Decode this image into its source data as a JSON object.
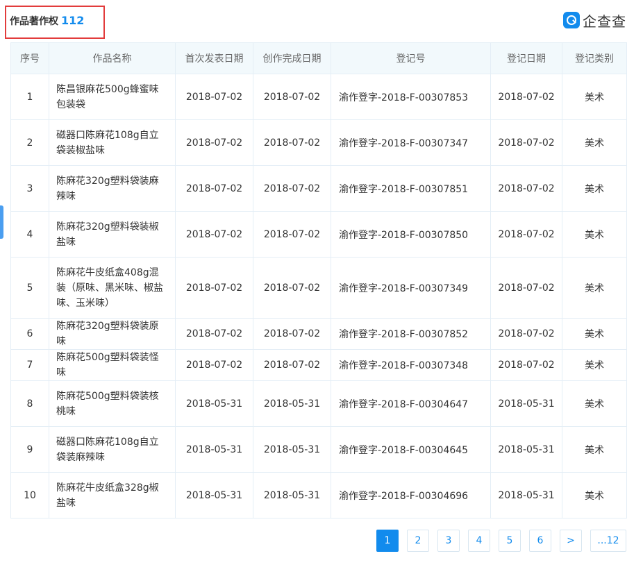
{
  "header": {
    "title": "作品著作权",
    "count": "112",
    "logo_text": "企查查"
  },
  "table": {
    "columns": [
      "序号",
      "作品名称",
      "首次发表日期",
      "创作完成日期",
      "登记号",
      "登记日期",
      "登记类别"
    ],
    "rows": [
      {
        "idx": "1",
        "name": "陈昌银麻花500g蜂蜜味包装袋",
        "first_pub": "2018-07-02",
        "completed": "2018-07-02",
        "reg_no": "渝作登字-2018-F-00307853",
        "reg_date": "2018-07-02",
        "category": "美术"
      },
      {
        "idx": "2",
        "name": "磁器口陈麻花108g自立袋装椒盐味",
        "first_pub": "2018-07-02",
        "completed": "2018-07-02",
        "reg_no": "渝作登字-2018-F-00307347",
        "reg_date": "2018-07-02",
        "category": "美术"
      },
      {
        "idx": "3",
        "name": "陈麻花320g塑料袋装麻辣味",
        "first_pub": "2018-07-02",
        "completed": "2018-07-02",
        "reg_no": "渝作登字-2018-F-00307851",
        "reg_date": "2018-07-02",
        "category": "美术"
      },
      {
        "idx": "4",
        "name": "陈麻花320g塑料袋装椒盐味",
        "first_pub": "2018-07-02",
        "completed": "2018-07-02",
        "reg_no": "渝作登字-2018-F-00307850",
        "reg_date": "2018-07-02",
        "category": "美术"
      },
      {
        "idx": "5",
        "name": "陈麻花牛皮纸盒408g混装（原味、黑米味、椒盐味、玉米味）",
        "first_pub": "2018-07-02",
        "completed": "2018-07-02",
        "reg_no": "渝作登字-2018-F-00307349",
        "reg_date": "2018-07-02",
        "category": "美术"
      },
      {
        "idx": "6",
        "name": "陈麻花320g塑料袋装原味",
        "first_pub": "2018-07-02",
        "completed": "2018-07-02",
        "reg_no": "渝作登字-2018-F-00307852",
        "reg_date": "2018-07-02",
        "category": "美术"
      },
      {
        "idx": "7",
        "name": "陈麻花500g塑料袋装怪味",
        "first_pub": "2018-07-02",
        "completed": "2018-07-02",
        "reg_no": "渝作登字-2018-F-00307348",
        "reg_date": "2018-07-02",
        "category": "美术"
      },
      {
        "idx": "8",
        "name": "陈麻花500g塑料袋装核桃味",
        "first_pub": "2018-05-31",
        "completed": "2018-05-31",
        "reg_no": "渝作登字-2018-F-00304647",
        "reg_date": "2018-05-31",
        "category": "美术"
      },
      {
        "idx": "9",
        "name": "磁器口陈麻花108g自立袋装麻辣味",
        "first_pub": "2018-05-31",
        "completed": "2018-05-31",
        "reg_no": "渝作登字-2018-F-00304645",
        "reg_date": "2018-05-31",
        "category": "美术"
      },
      {
        "idx": "10",
        "name": "陈麻花牛皮纸盒328g椒盐味",
        "first_pub": "2018-05-31",
        "completed": "2018-05-31",
        "reg_no": "渝作登字-2018-F-00304696",
        "reg_date": "2018-05-31",
        "category": "美术"
      }
    ]
  },
  "pagination": {
    "pages": [
      "1",
      "2",
      "3",
      "4",
      "5",
      "6",
      ">",
      "...12"
    ],
    "current": "1"
  },
  "colors": {
    "accent": "#128bed",
    "highlight_border": "#e23c3c",
    "header_bg": "#f2f9fc",
    "table_border": "#e4eef6"
  }
}
